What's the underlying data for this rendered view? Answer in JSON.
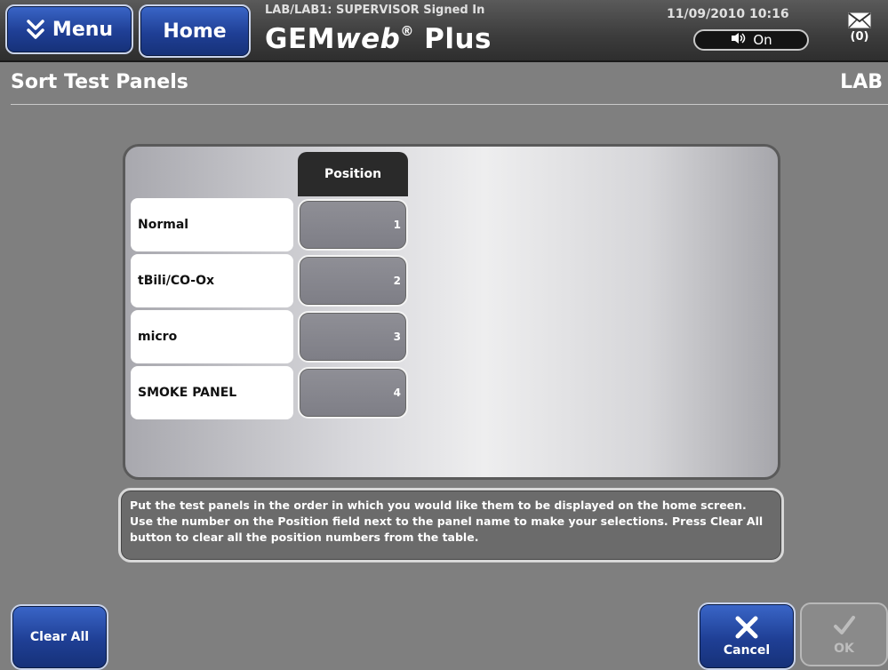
{
  "header": {
    "menu_label": "Menu",
    "home_label": "Home",
    "signin_status": "LAB/LAB1: SUPERVISOR Signed In",
    "brand_prefix": "GEM",
    "brand_web": "web",
    "brand_reg": "®",
    "brand_suffix": " Plus",
    "datetime": "11/09/2010 10:16",
    "toggle_label": "On",
    "mail_count": "(0)"
  },
  "page": {
    "title": "Sort Test Panels",
    "context": "LAB"
  },
  "table": {
    "position_header": "Position",
    "rows": [
      {
        "name": "Normal",
        "position": "1"
      },
      {
        "name": "tBili/CO-Ox",
        "position": "2"
      },
      {
        "name": "micro",
        "position": "3"
      },
      {
        "name": "SMOKE PANEL",
        "position": "4"
      }
    ]
  },
  "instructions": "Put the test panels in the order in which you would like them to be displayed on the home screen. Use the number on the Position field next to the panel name to make your selections. Press Clear All button to clear all the position numbers from the table.",
  "footer": {
    "clear_all_label": "Clear All",
    "cancel_label": "Cancel",
    "ok_label": "OK"
  },
  "icons": {
    "menu": "chevron-double-down-icon",
    "toggle": "speaker-icon",
    "mail": "envelope-icon",
    "cancel": "close-icon",
    "ok": "checkmark-icon"
  },
  "colors": {
    "button_blue": "#1f3f95",
    "background": "#7f7f7f",
    "topbar": "#3c3c3c",
    "position_header": "#2a2a2a"
  }
}
